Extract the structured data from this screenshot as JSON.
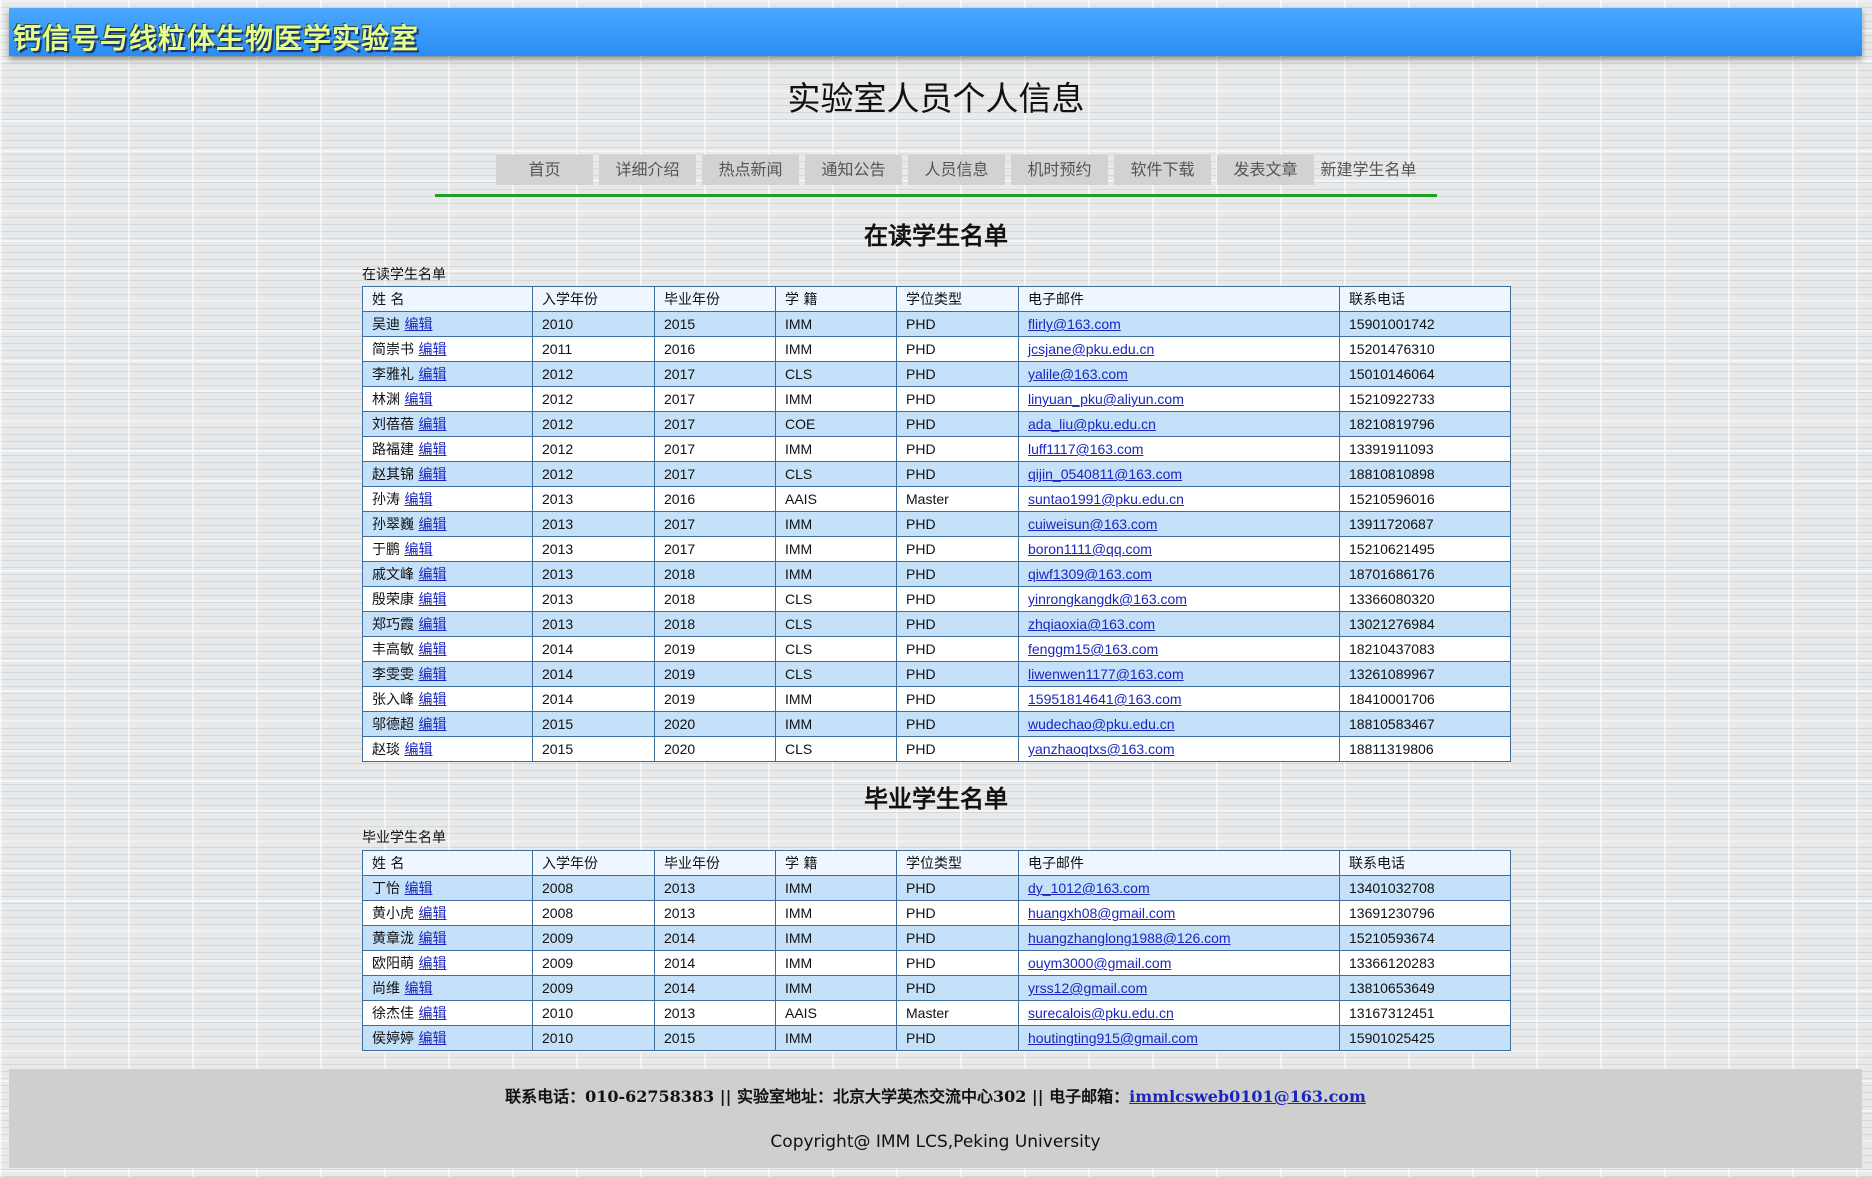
{
  "banner": {
    "title": "钙信号与线粒体生物医学实验室"
  },
  "page_title": "实验室人员个人信息",
  "nav": [
    "首页",
    "详细介绍",
    "热点新闻",
    "通知公告",
    "人员信息",
    "机时预约",
    "软件下载",
    "发表文章",
    "新建学生名单"
  ],
  "columns": [
    "姓 名",
    "入学年份",
    "毕业年份",
    "学 籍",
    "学位类型",
    "电子邮件",
    "联系电话"
  ],
  "edit_label": "编辑",
  "current": {
    "heading": "在读学生名单",
    "caption": "在读学生名单",
    "rows": [
      [
        "吴迪",
        "2010",
        "2015",
        "IMM",
        "PHD",
        "flirly@163.com",
        "15901001742"
      ],
      [
        "简崇书",
        "2011",
        "2016",
        "IMM",
        "PHD",
        "jcsjane@pku.edu.cn",
        "15201476310"
      ],
      [
        "李雅礼",
        "2012",
        "2017",
        "CLS",
        "PHD",
        "yalile@163.com",
        "15010146064"
      ],
      [
        "林渊",
        "2012",
        "2017",
        "IMM",
        "PHD",
        "linyuan_pku@aliyun.com",
        "15210922733"
      ],
      [
        "刘蓓蓓",
        "2012",
        "2017",
        "COE",
        "PHD",
        "ada_liu@pku.edu.cn",
        "18210819796"
      ],
      [
        "路福建",
        "2012",
        "2017",
        "IMM",
        "PHD",
        "luff1117@163.com",
        "13391911093"
      ],
      [
        "赵其锦",
        "2012",
        "2017",
        "CLS",
        "PHD",
        "qijin_0540811@163.com",
        "18810810898"
      ],
      [
        "孙涛",
        "2013",
        "2016",
        "AAIS",
        "Master",
        "suntao1991@pku.edu.cn",
        "15210596016"
      ],
      [
        "孙翠巍",
        "2013",
        "2017",
        "IMM",
        "PHD",
        "cuiweisun@163.com",
        "13911720687"
      ],
      [
        "于鹏",
        "2013",
        "2017",
        "IMM",
        "PHD",
        "boron1111@qq.com",
        "15210621495"
      ],
      [
        "戚文峰",
        "2013",
        "2018",
        "IMM",
        "PHD",
        "qiwf1309@163.com",
        "18701686176"
      ],
      [
        "殷荣康",
        "2013",
        "2018",
        "CLS",
        "PHD",
        "yinrongkangdk@163.com",
        "13366080320"
      ],
      [
        "郑巧霞",
        "2013",
        "2018",
        "CLS",
        "PHD",
        "zhqiaoxia@163.com",
        "13021276984"
      ],
      [
        "丰高敏",
        "2014",
        "2019",
        "CLS",
        "PHD",
        "fenggm15@163.com",
        "18210437083"
      ],
      [
        "李雯雯",
        "2014",
        "2019",
        "CLS",
        "PHD",
        "liwenwen1177@163.com",
        "13261089967"
      ],
      [
        "张入峰",
        "2014",
        "2019",
        "IMM",
        "PHD",
        "15951814641@163.com",
        "18410001706"
      ],
      [
        "邬德超",
        "2015",
        "2020",
        "IMM",
        "PHD",
        "wudechao@pku.edu.cn",
        "18810583467"
      ],
      [
        "赵琰",
        "2015",
        "2020",
        "CLS",
        "PHD",
        "yanzhaoqtxs@163.com",
        "18811319806"
      ]
    ]
  },
  "graduated": {
    "heading": "毕业学生名单",
    "caption": "毕业学生名单",
    "rows": [
      [
        "丁怡",
        "2008",
        "2013",
        "IMM",
        "PHD",
        "dy_1012@163.com",
        "13401032708"
      ],
      [
        "黄小虎",
        "2008",
        "2013",
        "IMM",
        "PHD",
        "huangxh08@gmail.com",
        "13691230796"
      ],
      [
        "黄章泷",
        "2009",
        "2014",
        "IMM",
        "PHD",
        "huangzhanglong1988@126.com",
        "15210593674"
      ],
      [
        "欧阳萌",
        "2009",
        "2014",
        "IMM",
        "PHD",
        "ouym3000@gmail.com",
        "13366120283"
      ],
      [
        "尚维",
        "2009",
        "2014",
        "IMM",
        "PHD",
        "yrss12@gmail.com",
        "13810653649"
      ],
      [
        "徐杰佳",
        "2010",
        "2013",
        "AAIS",
        "Master",
        "surecalois@pku.edu.cn",
        "13167312451"
      ],
      [
        "侯婷婷",
        "2010",
        "2015",
        "IMM",
        "PHD",
        "houtingting915@gmail.com",
        "15901025425"
      ]
    ]
  },
  "footer": {
    "contact_text": "联系电话：010-62758383 || 实验室地址：北京大学英杰交流中心302 || 电子邮箱：",
    "email": "immlcsweb0101@163.com",
    "copyright": "Copyright@ IMM LCS,Peking University"
  }
}
